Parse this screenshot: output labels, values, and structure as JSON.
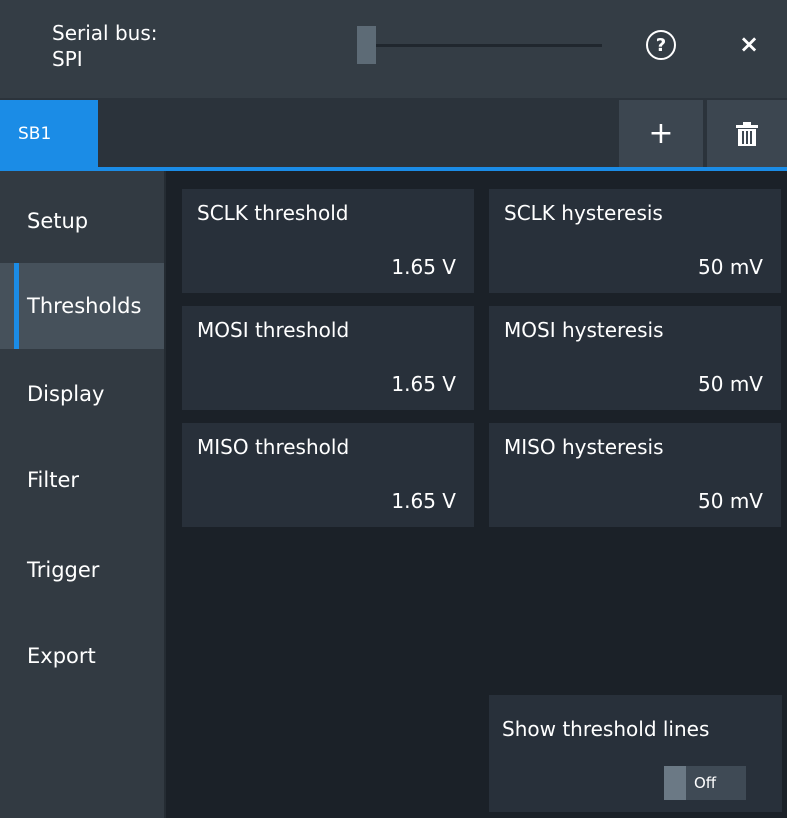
{
  "window": {
    "title_line1": "Serial bus:",
    "title_line2": "SPI",
    "help_icon": "?",
    "close_icon": "×"
  },
  "tabs": {
    "items": [
      "SB1"
    ],
    "add_label": "+",
    "delete_icon": "trash-icon"
  },
  "sidebar": {
    "items": [
      {
        "label": "Setup",
        "active": false
      },
      {
        "label": "Thresholds",
        "active": true
      },
      {
        "label": "Display",
        "active": false
      },
      {
        "label": "Filter",
        "active": false
      },
      {
        "label": "Trigger",
        "active": false
      },
      {
        "label": "Export",
        "active": false
      }
    ]
  },
  "fields": {
    "sclk_threshold": {
      "label": "SCLK threshold",
      "value": "1.65 V"
    },
    "sclk_hysteresis": {
      "label": "SCLK hysteresis",
      "value": "50 mV"
    },
    "mosi_threshold": {
      "label": "MOSI threshold",
      "value": "1.65 V"
    },
    "mosi_hysteresis": {
      "label": "MOSI hysteresis",
      "value": "50 mV"
    },
    "miso_threshold": {
      "label": "MISO threshold",
      "value": "1.65 V"
    },
    "miso_hysteresis": {
      "label": "MISO hysteresis",
      "value": "50 mV"
    }
  },
  "threshold_lines": {
    "label": "Show threshold lines",
    "state": "Off"
  },
  "colors": {
    "accent": "#1b8ce6",
    "background": "#1b2128",
    "panel": "#28303a"
  }
}
